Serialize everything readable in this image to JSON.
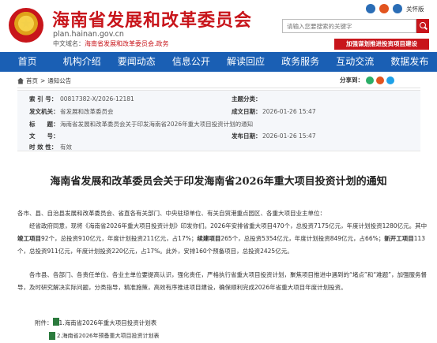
{
  "header": {
    "site_title": "海南省发展和改革委员会",
    "site_url": "plan.hainan.gov.cn",
    "site_sub_prefix": "中文域名：",
    "site_sub_name": "海南省发展和改革委员会.政务",
    "care_label": "关怀版",
    "search_placeholder": "请输入您要搜索的关键字",
    "promo_button": "加强谋划推进投资项目建设"
  },
  "nav": {
    "items": [
      "首页",
      "机构介绍",
      "要闻动态",
      "信息公开",
      "解读回应",
      "政务服务",
      "互动交流",
      "数据发布"
    ]
  },
  "breadcrumb": {
    "home": "首页",
    "sep": ">",
    "current": "通知公告",
    "share_label": "分享到："
  },
  "info": {
    "index_key": "索 引 号：",
    "index_val": "00817382-X/2026-12181",
    "topic_key": "主题分类：",
    "topic_val": "",
    "issuer_key": "发文机关：",
    "issuer_val": "省发展和改革委员会",
    "date_key": "成文日期：",
    "date_val": "2026-01-26 15:47",
    "title_key": "标　　题：",
    "title_val": "海南省发展和改革委员会关于印发海南省2026年重大项目投资计划的通知",
    "docno_key": "文　　号：",
    "docno_val": "",
    "pubdate_key": "发布日期：",
    "pubdate_val": "2026-01-26 15:47",
    "validity_key": "时 效 性：",
    "validity_val": "有效"
  },
  "article": {
    "title": "海南省发展和改革委员会关于印发海南省2026年重大项目投资计划的通知",
    "p1": "各市、县、自治县发展和改革委员会、省直各有关部门、中央驻琼单位、有关自贸港重点园区、各重大项目业主单位：",
    "p2_a": "经省政府同意，现将《海南省2026年重大项目投资计划》印发你们。2026年安排省重大项目470个，总投资7175亿元，年度计划投资1280亿元。其中",
    "p2_b1": "竣工项目",
    "p2_c": "92个，总投资910亿元，年度计划投资211亿元，占17%；",
    "p2_b2": "续建项目",
    "p2_d": "265个，总投资5354亿元，年度计划投资849亿元，占66%；",
    "p2_b3": "新开工项目",
    "p2_e": "113个，总投资911亿元，年度计划投资220亿元，占17%。此外，安排160个预备项目，总投资2425亿元。",
    "p3": "各市县、各部门、各责任单位、各业主单位要提高认识，强化责任，严格执行省重大项目投资计划，聚焦项目推进中遇到的“堵点”和“难题”，加强服务督导，及时研究解决实际问题，分类指导，精准施策，高效有序推进项目建设，确保顺利完成2026年省重大项目年度计划投资。",
    "attach_label": "附件：",
    "attach1": "1.海南省2026年重大项目投资计划表",
    "attach2": "2.海南省2026年预备重大项目投资计划表"
  },
  "colors": {
    "brand_red": "#c8151b",
    "nav_blue": "#1a5fb4"
  }
}
